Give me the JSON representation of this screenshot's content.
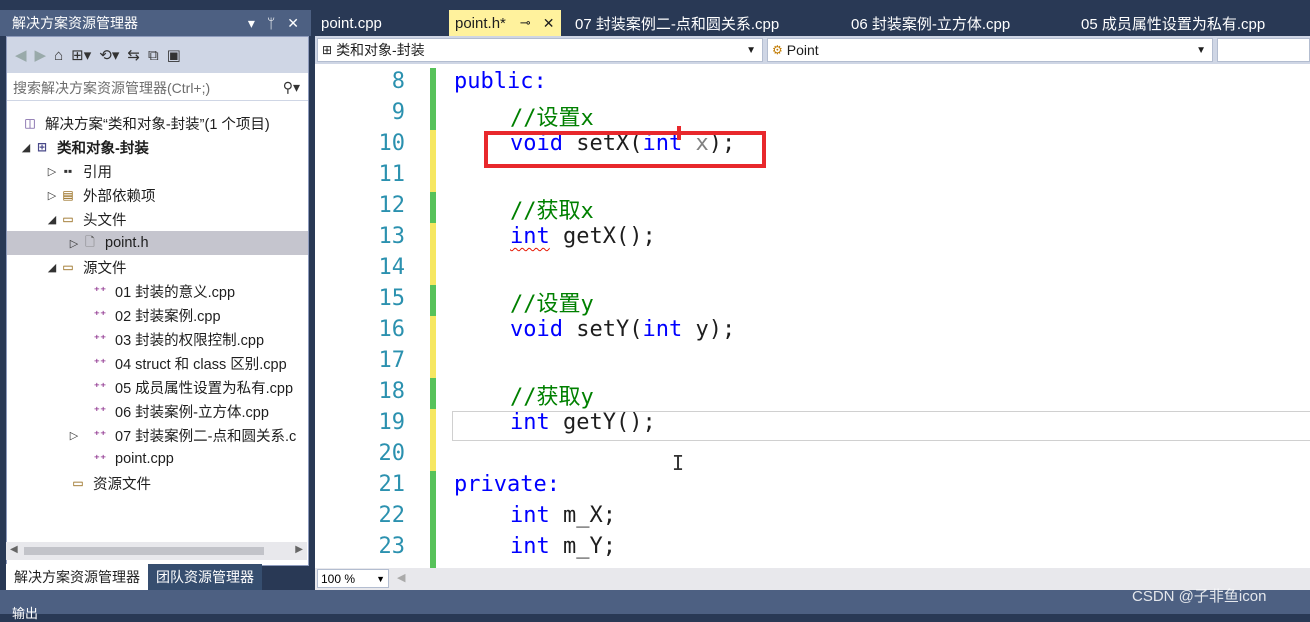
{
  "solution_explorer": {
    "title": "解决方案资源管理器",
    "title_controls": [
      "▾",
      "ᛘ",
      "✕"
    ],
    "search_placeholder": "搜索解决方案资源管理器(Ctrl+;)",
    "tree": [
      {
        "label": "解决方案“类和对象-封装”(1 个项目)",
        "icon": "solution-icon"
      },
      {
        "label": "类和对象-封装",
        "icon": "project-icon",
        "expanded": true
      },
      {
        "label": "引用",
        "icon": "references-icon"
      },
      {
        "label": "外部依赖项",
        "icon": "external-deps-icon"
      },
      {
        "label": "头文件",
        "icon": "folder-icon",
        "expanded": true
      },
      {
        "label": "point.h",
        "icon": "header-file-icon",
        "selected": true
      },
      {
        "label": "源文件",
        "icon": "folder-icon",
        "expanded": true
      },
      {
        "label": "01 封装的意义.cpp",
        "icon": "cpp-file-icon"
      },
      {
        "label": "02 封装案例.cpp",
        "icon": "cpp-file-icon"
      },
      {
        "label": "03 封装的权限控制.cpp",
        "icon": "cpp-file-icon"
      },
      {
        "label": "04 struct 和 class 区别.cpp",
        "icon": "cpp-file-icon"
      },
      {
        "label": "05 成员属性设置为私有.cpp",
        "icon": "cpp-file-icon"
      },
      {
        "label": "06 封装案例-立方体.cpp",
        "icon": "cpp-file-icon"
      },
      {
        "label": "07 封装案例二-点和圆关系.c",
        "icon": "cpp-file-icon"
      },
      {
        "label": "point.cpp",
        "icon": "cpp-file-icon"
      },
      {
        "label": "资源文件",
        "icon": "folder-icon"
      }
    ],
    "bottom_tabs": [
      "解决方案资源管理器",
      "团队资源管理器"
    ]
  },
  "editor_tabs": [
    {
      "label": "point.cpp",
      "active": false
    },
    {
      "label": "point.h*",
      "active": true
    },
    {
      "label": "07 封装案例二-点和圆关系.cpp",
      "active": false
    },
    {
      "label": "06 封装案例-立方体.cpp",
      "active": false
    },
    {
      "label": "05 成员属性设置为私有.cpp",
      "active": false
    }
  ],
  "navbar": {
    "scope": "类和对象-封装",
    "member": "Point"
  },
  "code": {
    "lines": [
      {
        "n": "8",
        "text": "public:"
      },
      {
        "n": "9",
        "text": "//设置x"
      },
      {
        "n": "10",
        "text": "void setX(int x);"
      },
      {
        "n": "11",
        "text": ""
      },
      {
        "n": "12",
        "text": "//获取x"
      },
      {
        "n": "13",
        "text": "int getX();"
      },
      {
        "n": "14",
        "text": ""
      },
      {
        "n": "15",
        "text": "//设置y"
      },
      {
        "n": "16",
        "text": "void setY(int y);"
      },
      {
        "n": "17",
        "text": ""
      },
      {
        "n": "18",
        "text": "//获取y"
      },
      {
        "n": "19",
        "text": "int getY();"
      },
      {
        "n": "20",
        "text": ""
      },
      {
        "n": "21",
        "text": "private:"
      },
      {
        "n": "22",
        "text": "int m_X;"
      },
      {
        "n": "23",
        "text": "int m_Y;"
      }
    ]
  },
  "zoom": "100 %",
  "output_label": "输出",
  "watermark": "CSDN @子非鱼icon",
  "colors": {
    "keyword": "#0000ff",
    "comment": "#008000",
    "line_number": "#2b91af",
    "highlight_box": "#e8282c",
    "active_tab": "#fff29d"
  }
}
